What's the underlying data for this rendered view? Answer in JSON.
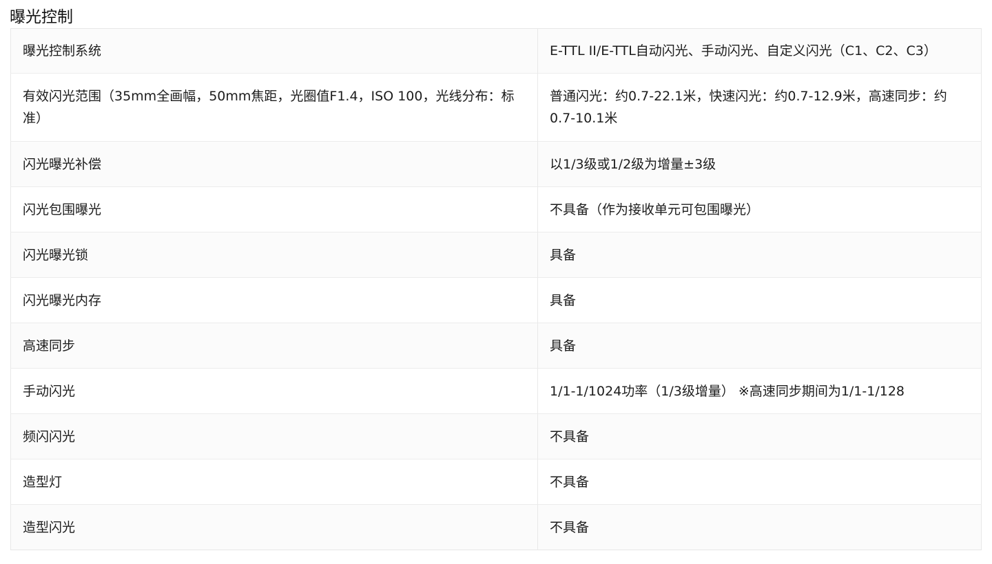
{
  "section": {
    "title": "曝光控制"
  },
  "table": {
    "rows": [
      {
        "label": "曝光控制系统",
        "value": "E-TTL II/E-TTL自动闪光、手动闪光、自定义闪光（C1、C2、C3）"
      },
      {
        "label": "有效闪光范围（35mm全画幅，50mm焦距，光圈值F1.4，ISO 100，光线分布：标准）",
        "value": "普通闪光：约0.7-22.1米，快速闪光：约0.7-12.9米，高速同步：约0.7-10.1米"
      },
      {
        "label": "闪光曝光补偿",
        "value": "以1/3级或1/2级为增量±3级"
      },
      {
        "label": "闪光包围曝光",
        "value": "不具备（作为接收单元可包围曝光）"
      },
      {
        "label": "闪光曝光锁",
        "value": "具备"
      },
      {
        "label": "闪光曝光内存",
        "value": "具备"
      },
      {
        "label": "高速同步",
        "value": "具备"
      },
      {
        "label": "手动闪光",
        "value": "1/1-1/1024功率（1/3级增量） ※高速同步期间为1/1-1/128"
      },
      {
        "label": "频闪闪光",
        "value": "不具备"
      },
      {
        "label": "造型灯",
        "value": "不具备"
      },
      {
        "label": "造型闪光",
        "value": "不具备"
      }
    ]
  }
}
